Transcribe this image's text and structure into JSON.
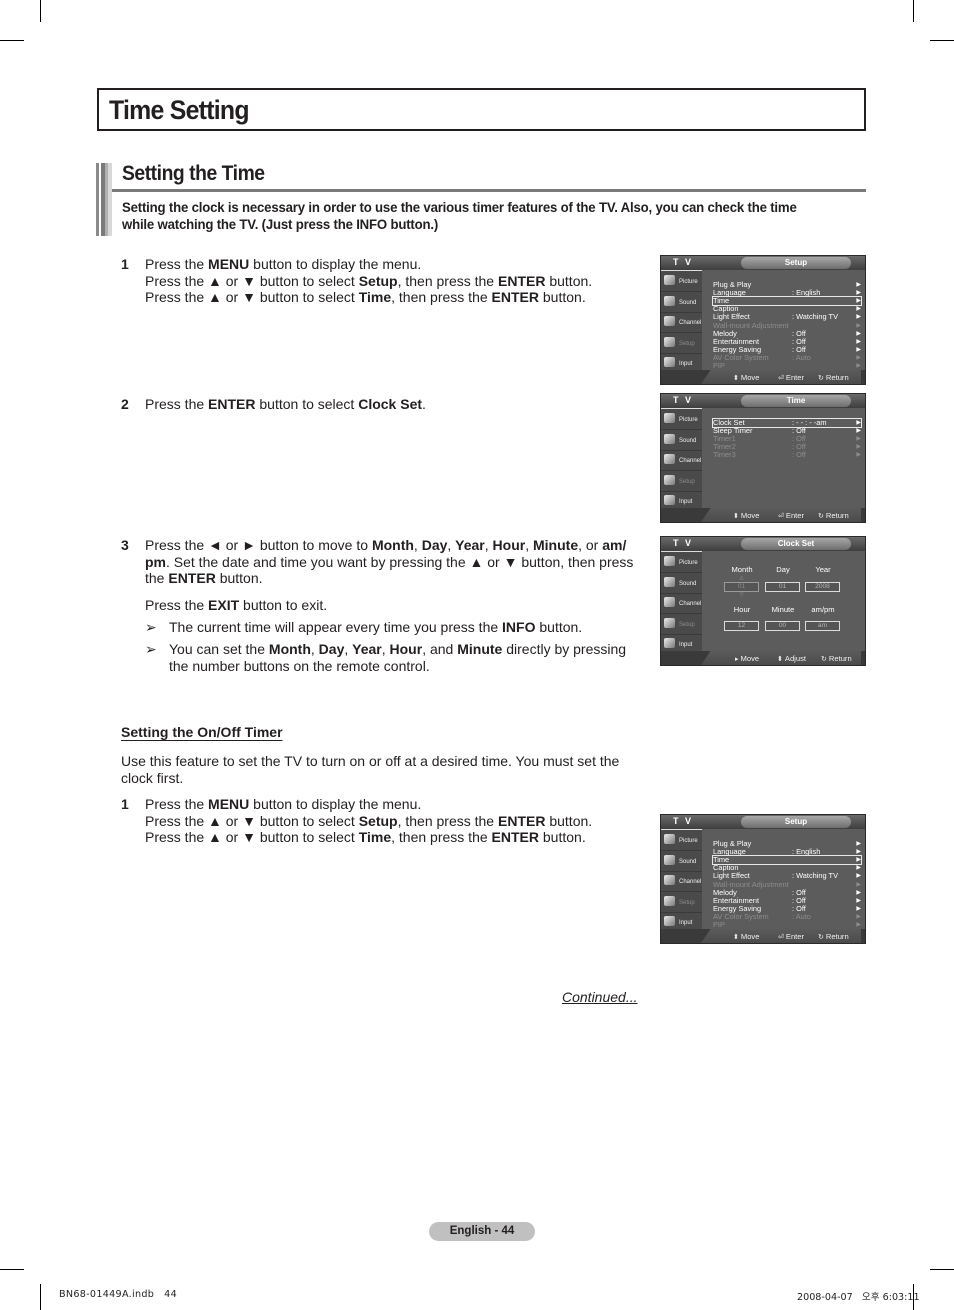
{
  "page": {
    "title": "Time Setting",
    "section_title": "Setting the Time",
    "intro_lines": [
      "Setting the clock is necessary in order to use the various timer features of the TV. Also, you can check the time",
      "while watching the TV. (Just press the INFO button.)"
    ]
  },
  "steps": [
    {
      "num": "1",
      "lines": [
        [
          {
            "t": "Press the "
          },
          {
            "t": "MENU",
            "b": true
          },
          {
            "t": " button to display the menu."
          }
        ],
        [
          {
            "t": "Press the ▲ or ▼ button to select "
          },
          {
            "t": "Setup",
            "b": true
          },
          {
            "t": ", then press the "
          },
          {
            "t": "ENTER",
            "b": true
          },
          {
            "t": " button."
          }
        ],
        [
          {
            "t": "Press the ▲ or ▼ button to select "
          },
          {
            "t": "Time",
            "b": true
          },
          {
            "t": ", then press the "
          },
          {
            "t": "ENTER",
            "b": true
          },
          {
            "t": " button."
          }
        ]
      ]
    },
    {
      "num": "2",
      "lines": [
        [
          {
            "t": "Press the "
          },
          {
            "t": "ENTER",
            "b": true
          },
          {
            "t": " button to select "
          },
          {
            "t": "Clock Set",
            "b": true
          },
          {
            "t": "."
          }
        ]
      ]
    },
    {
      "num": "3",
      "lines": [
        [
          {
            "t": "Press the ◄ or ► button to move to "
          },
          {
            "t": "Month",
            "b": true
          },
          {
            "t": ", "
          },
          {
            "t": "Day",
            "b": true
          },
          {
            "t": ", "
          },
          {
            "t": "Year",
            "b": true
          },
          {
            "t": ", "
          },
          {
            "t": "Hour",
            "b": true
          },
          {
            "t": ", "
          },
          {
            "t": "Minute",
            "b": true
          },
          {
            "t": ", or "
          },
          {
            "t": "am/",
            "b": true
          }
        ],
        [
          {
            "t": "pm",
            "b": true
          },
          {
            "t": ". Set the date and time you want by pressing the ▲ or ▼ button, then press"
          }
        ],
        [
          {
            "t": "the "
          },
          {
            "t": "ENTER",
            "b": true
          },
          {
            "t": " button."
          }
        ]
      ],
      "exit_line": [
        {
          "t": "Press the "
        },
        {
          "t": "EXIT",
          "b": true
        },
        {
          "t": " button to exit."
        }
      ],
      "notes": [
        {
          "arrow": "➢",
          "lines": [
            [
              {
                "t": "The current time will appear every time you press the "
              },
              {
                "t": "INFO",
                "b": true
              },
              {
                "t": " button."
              }
            ]
          ]
        },
        {
          "arrow": "➢",
          "lines": [
            [
              {
                "t": "You can set the "
              },
              {
                "t": "Month",
                "b": true
              },
              {
                "t": ", "
              },
              {
                "t": "Day",
                "b": true
              },
              {
                "t": ", "
              },
              {
                "t": "Year",
                "b": true
              },
              {
                "t": ", "
              },
              {
                "t": "Hour",
                "b": true
              },
              {
                "t": ", and "
              },
              {
                "t": "Minute",
                "b": true
              },
              {
                "t": " directly by pressing"
              }
            ],
            [
              {
                "t": "the number buttons on the remote control."
              }
            ]
          ]
        }
      ]
    }
  ],
  "timer_section": {
    "subhead": "Setting the On/Off Timer",
    "para_lines": [
      "Use this feature to set the TV to turn on or off at a desired time. You must set the",
      "clock first."
    ],
    "step1": {
      "num": "1",
      "lines": [
        [
          {
            "t": "Press the "
          },
          {
            "t": "MENU",
            "b": true
          },
          {
            "t": " button to display the menu."
          }
        ],
        [
          {
            "t": "Press the ▲ or ▼ button to select "
          },
          {
            "t": "Setup",
            "b": true
          },
          {
            "t": ", then press the "
          },
          {
            "t": "ENTER",
            "b": true
          },
          {
            "t": " button."
          }
        ],
        [
          {
            "t": "Press the ▲ or ▼ button to select "
          },
          {
            "t": "Time",
            "b": true
          },
          {
            "t": ", then press the "
          },
          {
            "t": "ENTER",
            "b": true
          },
          {
            "t": " button."
          }
        ]
      ]
    },
    "continued": "Continued..."
  },
  "osd_common": {
    "tv_label": "T V",
    "sidebar": [
      {
        "label": "Picture",
        "icon": "picture-icon",
        "dim": false
      },
      {
        "label": "Sound",
        "icon": "sound-icon",
        "dim": false
      },
      {
        "label": "Channel",
        "icon": "channel-icon",
        "dim": false
      },
      {
        "label": "Setup",
        "icon": "setup-icon",
        "dim": true
      },
      {
        "label": "Input",
        "icon": "input-icon",
        "dim": false
      }
    ]
  },
  "osd_setup": {
    "tab": "Setup",
    "rows": [
      {
        "label": "Plug & Play",
        "value": "",
        "dim": false,
        "sel": false
      },
      {
        "label": "Language",
        "value": ": English",
        "dim": false,
        "sel": false
      },
      {
        "label": "Time",
        "value": "",
        "dim": false,
        "sel": true
      },
      {
        "label": "Caption",
        "value": "",
        "dim": false,
        "sel": false
      },
      {
        "label": "Light Effect",
        "value": ": Watching TV",
        "dim": false,
        "sel": false
      },
      {
        "label": "Wall-mount Adjustment",
        "value": "",
        "dim": true,
        "sel": false
      },
      {
        "label": "Melody",
        "value": ": Off",
        "dim": false,
        "sel": false
      },
      {
        "label": "Entertainment",
        "value": ": Off",
        "dim": false,
        "sel": false
      },
      {
        "label": "Energy Saving",
        "value": ": Off",
        "dim": false,
        "sel": false
      },
      {
        "label": "AV Color System",
        "value": ": Auto",
        "dim": true,
        "sel": false
      },
      {
        "label": "PIP",
        "value": "",
        "dim": true,
        "sel": false
      }
    ],
    "hints": [
      {
        "icon": "updown-icon",
        "glyph": "⬍",
        "label": "Move"
      },
      {
        "icon": "enter-icon",
        "glyph": "⏎",
        "label": "Enter"
      },
      {
        "icon": "return-icon",
        "glyph": "↻",
        "label": "Return"
      }
    ]
  },
  "osd_time": {
    "tab": "Time",
    "rows": [
      {
        "label": "Clock Set",
        "value": ": - - : - -am",
        "dim": false,
        "sel": true
      },
      {
        "label": "Sleep Timer",
        "value": ": Off",
        "dim": false,
        "sel": false
      },
      {
        "label": "Timer1",
        "value": ": Off",
        "dim": true,
        "sel": false
      },
      {
        "label": "Timer2",
        "value": ": Off",
        "dim": true,
        "sel": false
      },
      {
        "label": "Timer3",
        "value": ": Off",
        "dim": true,
        "sel": false
      }
    ],
    "hints": [
      {
        "icon": "updown-icon",
        "glyph": "⬍",
        "label": "Move"
      },
      {
        "icon": "enter-icon",
        "glyph": "⏎",
        "label": "Enter"
      },
      {
        "icon": "return-icon",
        "glyph": "↻",
        "label": "Return"
      }
    ]
  },
  "osd_clock": {
    "tab": "Clock Set",
    "fields_row1": [
      {
        "label": "Month",
        "value": "01",
        "active": true
      },
      {
        "label": "Day",
        "value": "01",
        "active": false
      },
      {
        "label": "Year",
        "value": "2008",
        "active": false
      }
    ],
    "fields_row2": [
      {
        "label": "Hour",
        "value": "12",
        "active": false
      },
      {
        "label": "Minute",
        "value": "00",
        "active": false
      },
      {
        "label": "am/pm",
        "value": "am",
        "active": false
      }
    ],
    "hints": [
      {
        "icon": "right-arrow-icon",
        "glyph": "▸",
        "label": "Move"
      },
      {
        "icon": "updown-icon",
        "glyph": "⬍",
        "label": "Adjust"
      },
      {
        "icon": "return-icon",
        "glyph": "↻",
        "label": "Return"
      }
    ]
  },
  "footer": {
    "page_label": "English - 44",
    "print_file": "BN68-01449A.indb   44",
    "print_date": "2008-04-07   오후 6:03:11"
  }
}
